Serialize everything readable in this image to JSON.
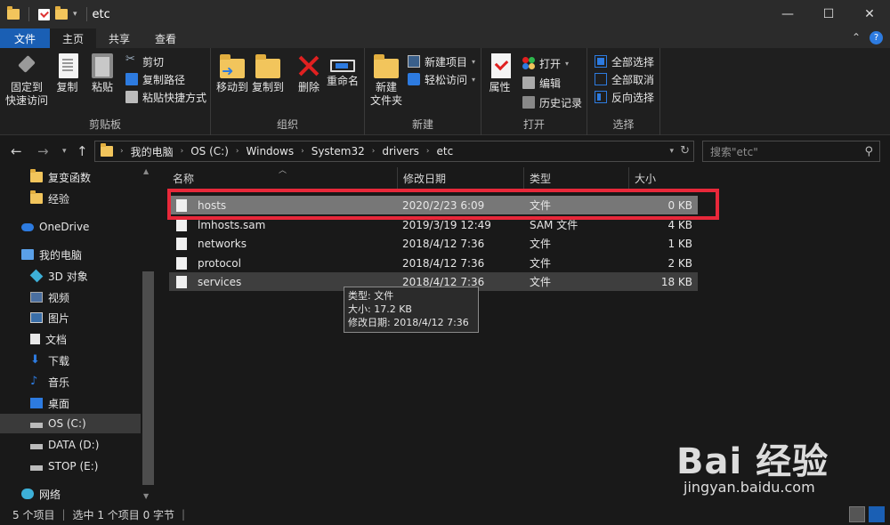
{
  "window": {
    "title": "etc",
    "controls": {
      "minimize": "—",
      "maximize": "☐",
      "close": "✕"
    }
  },
  "ribbon_tabs": [
    {
      "label": "文件"
    },
    {
      "label": "主页"
    },
    {
      "label": "共享"
    },
    {
      "label": "查看"
    }
  ],
  "ribbon": {
    "clipboard": {
      "pin_label1": "固定到",
      "pin_label2": "快速访问",
      "copy": "复制",
      "paste": "粘贴",
      "cut": "剪切",
      "copy_path": "复制路径",
      "paste_shortcut": "粘贴快捷方式",
      "group": "剪贴板"
    },
    "organize": {
      "move_to": "移动到",
      "copy_to": "复制到",
      "delete": "删除",
      "rename": "重命名",
      "group": "组织"
    },
    "new": {
      "new_folder1": "新建",
      "new_folder2": "文件夹",
      "new_item": "新建项目",
      "easy_access": "轻松访问",
      "group": "新建"
    },
    "open": {
      "properties": "属性",
      "open": "打开",
      "edit": "编辑",
      "history": "历史记录",
      "group": "打开"
    },
    "select": {
      "select_all": "全部选择",
      "select_none": "全部取消",
      "invert": "反向选择",
      "group": "选择"
    }
  },
  "address": {
    "crumbs": [
      "我的电脑",
      "OS (C:)",
      "Windows",
      "System32",
      "drivers",
      "etc"
    ],
    "search_placeholder": "搜索\"etc\""
  },
  "sidebar": [
    {
      "label": "复变函数",
      "icon": "folder-icon",
      "indent": 1
    },
    {
      "label": "经验",
      "icon": "folder-icon",
      "indent": 1
    },
    {
      "label": "OneDrive",
      "icon": "cloud-icon",
      "indent": 0
    },
    {
      "label": "我的电脑",
      "icon": "computer-icon",
      "indent": 0
    },
    {
      "label": "3D 对象",
      "icon": "cube-icon",
      "indent": 1
    },
    {
      "label": "视频",
      "icon": "video-icon",
      "indent": 1
    },
    {
      "label": "图片",
      "icon": "picture-icon",
      "indent": 1
    },
    {
      "label": "文档",
      "icon": "document-icon",
      "indent": 1
    },
    {
      "label": "下载",
      "icon": "download-icon",
      "indent": 1
    },
    {
      "label": "音乐",
      "icon": "music-icon",
      "indent": 1
    },
    {
      "label": "桌面",
      "icon": "desktop-icon",
      "indent": 1
    },
    {
      "label": "OS (C:)",
      "icon": "drive-icon",
      "indent": 1,
      "selected": true
    },
    {
      "label": "DATA (D:)",
      "icon": "drive-icon",
      "indent": 1
    },
    {
      "label": "STOP (E:)",
      "icon": "drive-icon",
      "indent": 1
    },
    {
      "label": "网络",
      "icon": "network-icon",
      "indent": 0
    }
  ],
  "columns": [
    "名称",
    "修改日期",
    "类型",
    "大小"
  ],
  "files": [
    {
      "name": "hosts",
      "date": "2020/2/23 6:09",
      "type": "文件",
      "size": "0 KB",
      "state": "selected"
    },
    {
      "name": "lmhosts.sam",
      "date": "2019/3/19 12:49",
      "type": "SAM 文件",
      "size": "4 KB",
      "state": ""
    },
    {
      "name": "networks",
      "date": "2018/4/12 7:36",
      "type": "文件",
      "size": "1 KB",
      "state": ""
    },
    {
      "name": "protocol",
      "date": "2018/4/12 7:36",
      "type": "文件",
      "size": "2 KB",
      "state": ""
    },
    {
      "name": "services",
      "date": "2018/4/12 7:36",
      "type": "文件",
      "size": "18 KB",
      "state": "hover"
    }
  ],
  "tooltip": {
    "type": "类型: 文件",
    "size": "大小: 17.2 KB",
    "modified": "修改日期: 2018/4/12 7:36"
  },
  "status": {
    "count": "5 个项目",
    "selected": "选中 1 个项目  0 字节"
  },
  "watermark": {
    "logo": "Bai  经验",
    "url": "jingyan.baidu.com"
  },
  "colors": {
    "accent": "#1a5fb4",
    "highlight_border": "#e8283a",
    "selected_row": "#777777"
  }
}
